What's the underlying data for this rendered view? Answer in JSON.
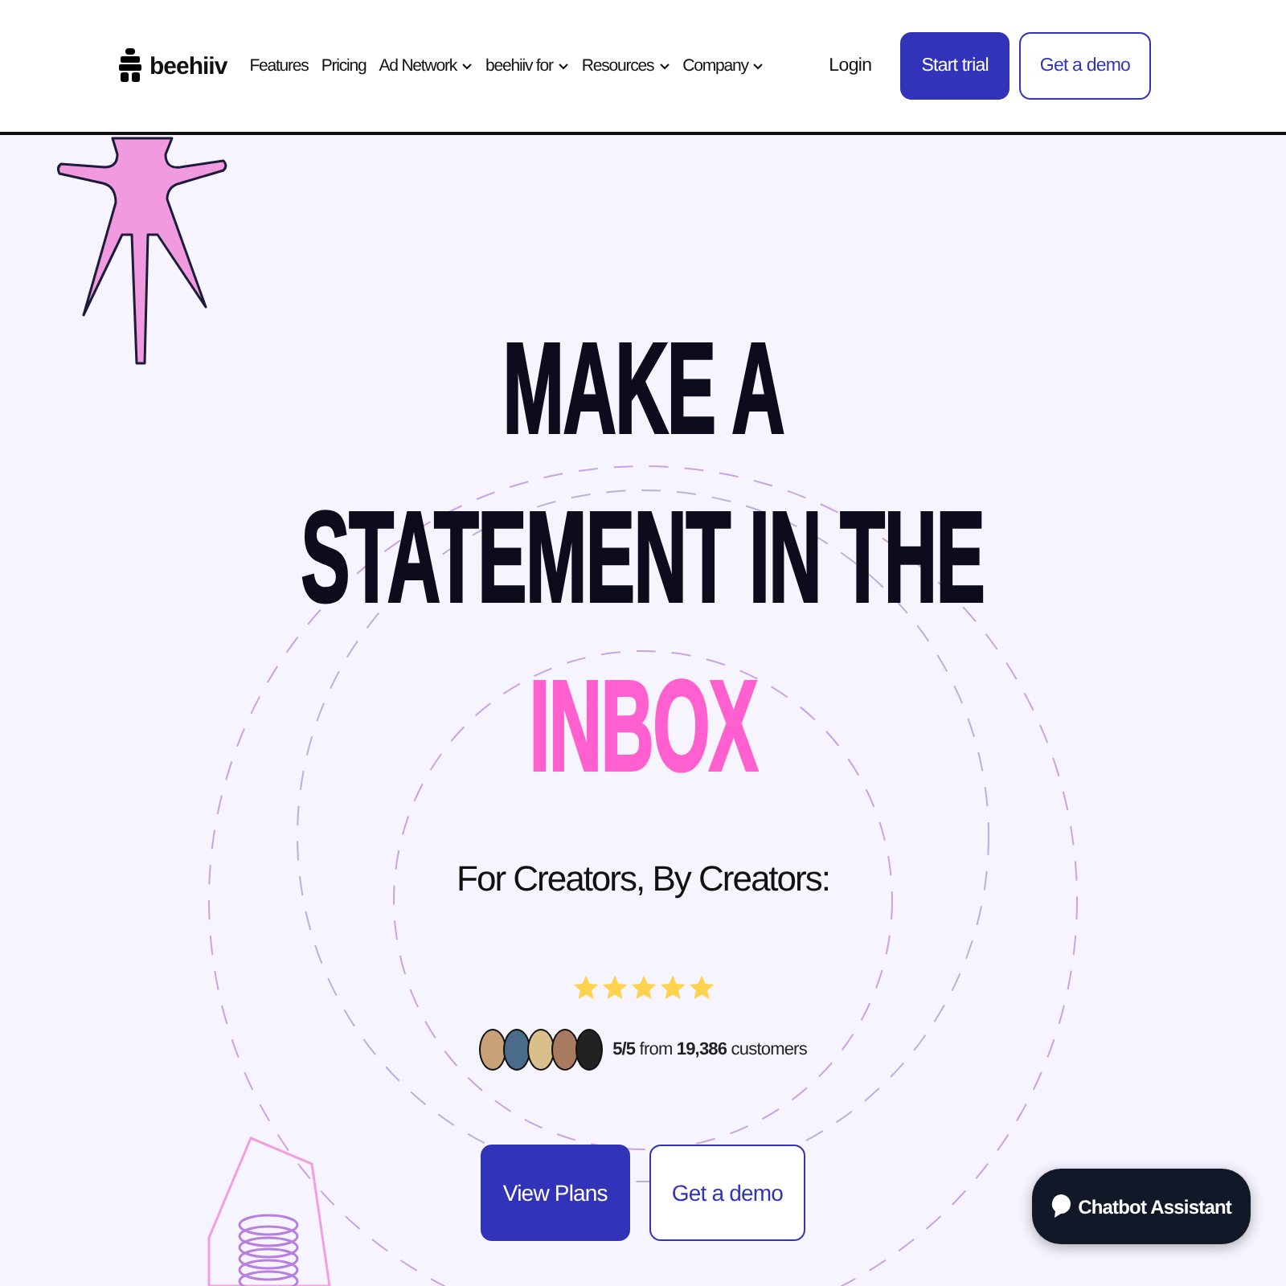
{
  "header": {
    "logo": "beehiiv",
    "nav": [
      {
        "label": "Features",
        "dropdown": false
      },
      {
        "label": "Pricing",
        "dropdown": false
      },
      {
        "label": "Ad Network",
        "dropdown": true
      },
      {
        "label": "beehiiv for",
        "dropdown": true
      },
      {
        "label": "Resources",
        "dropdown": true
      },
      {
        "label": "Company",
        "dropdown": true
      }
    ],
    "login": "Login",
    "primary": "Start trial",
    "secondary": "Get a demo"
  },
  "hero": {
    "title_lines": [
      {
        "text": "MAKE A",
        "accent": false
      },
      {
        "text": "STATEMENT IN THE",
        "accent": false
      },
      {
        "text": "INBOX",
        "accent": true
      }
    ],
    "subtitle": "For Creators, By Creators:",
    "stars": 5,
    "rating": "**5/5** from **19,386** customers",
    "buttons": [
      {
        "label": "View Plans",
        "kind": "primary"
      },
      {
        "label": "Get a demo",
        "kind": "secondary"
      }
    ]
  },
  "chatbot": "Chatbot Assistant"
}
